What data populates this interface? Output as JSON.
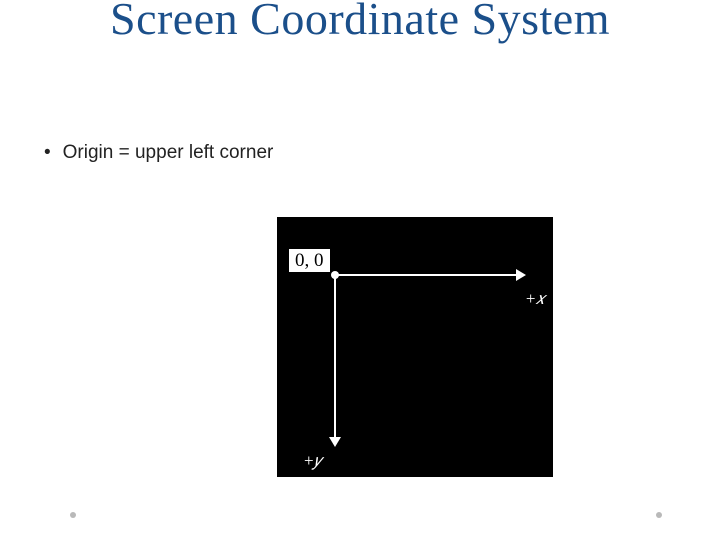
{
  "title": "Screen Coordinate System",
  "bullet": {
    "marker": "•",
    "text": "Origin = upper left corner"
  },
  "diagram": {
    "origin_label": "0, 0",
    "x_axis_label": "+x",
    "y_axis_label": "+y"
  }
}
